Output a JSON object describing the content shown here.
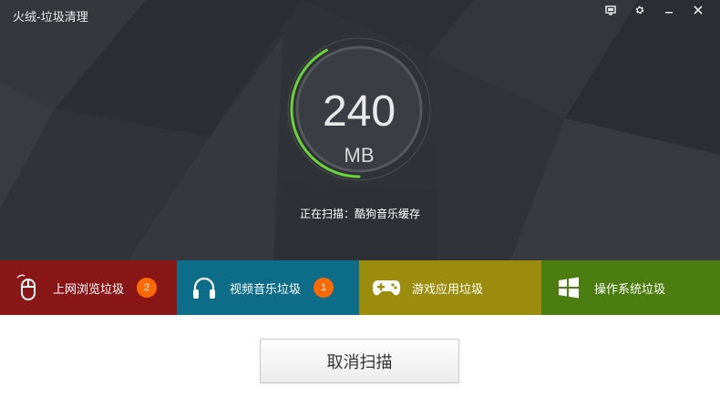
{
  "window": {
    "title": "火绒-垃圾清理",
    "controls": [
      "monitor-icon",
      "gear-icon",
      "minimize-icon",
      "close-icon"
    ]
  },
  "scan": {
    "size_value": "240",
    "size_unit": "MB",
    "status_text": "正在扫描：酷狗音乐缓存",
    "progress_fraction": 0.42
  },
  "categories": [
    {
      "label": "上网浏览垃圾",
      "icon": "mouse-icon",
      "badge": "2",
      "color": "#8a1717"
    },
    {
      "label": "视频音乐垃圾",
      "icon": "headphones-icon",
      "badge": "1",
      "color": "#0e6d88"
    },
    {
      "label": "游戏应用垃圾",
      "icon": "gamepad-icon",
      "badge": "",
      "color": "#9c8c0d"
    },
    {
      "label": "操作系统垃圾",
      "icon": "windows-logo-icon",
      "badge": "",
      "color": "#4b7d10"
    }
  ],
  "actions": {
    "cancel_label": "取消扫描"
  },
  "colors": {
    "gauge_arc": "#6ad43a",
    "badge": "#ff6a00"
  }
}
